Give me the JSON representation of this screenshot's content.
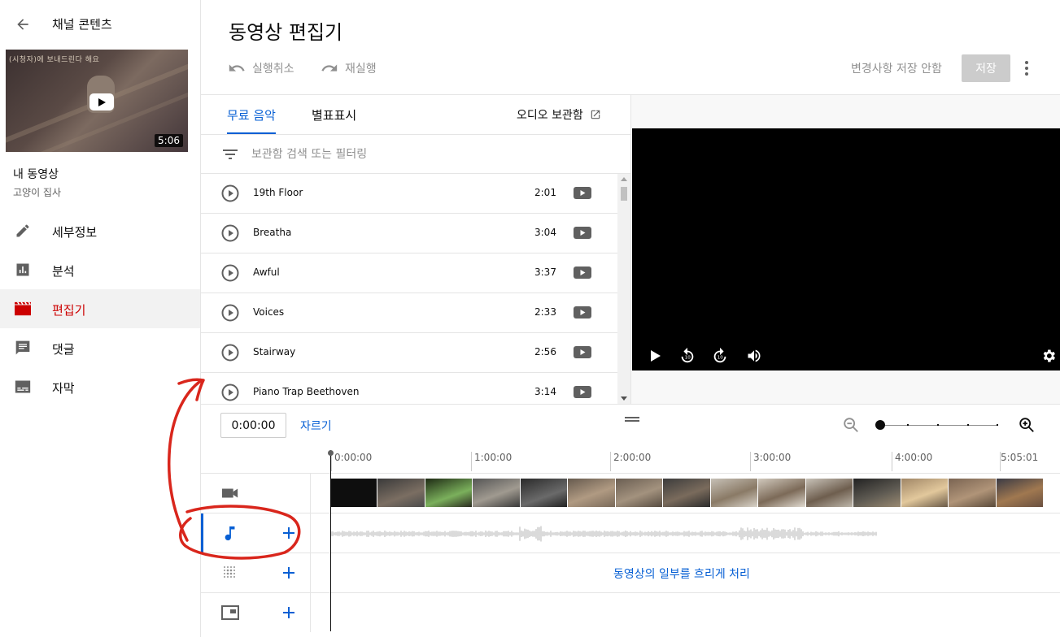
{
  "sidebar": {
    "back_label": "채널 콘텐츠",
    "video": {
      "duration": "5:06",
      "thumb_caption": "(시청자)에 보내드린다 해요"
    },
    "my_video_label": "내 동영상",
    "owner": "고양이 집사",
    "items": [
      {
        "label": "세부정보",
        "icon": "pencil-icon"
      },
      {
        "label": "분석",
        "icon": "analytics-icon"
      },
      {
        "label": "편집기",
        "icon": "clapperboard-icon",
        "active": true
      },
      {
        "label": "댓글",
        "icon": "comment-icon"
      },
      {
        "label": "자막",
        "icon": "subtitles-icon"
      }
    ]
  },
  "header": {
    "title": "동영상 편집기",
    "undo": "실행취소",
    "redo": "재실행",
    "discard": "변경사항 저장 안함",
    "save": "저장"
  },
  "panel": {
    "tabs": [
      "무료 음악",
      "별표표시"
    ],
    "active_tab": 0,
    "audio_library": "오디오 보관함",
    "filter_placeholder": "보관함 검색 또는 필터링",
    "tracks": [
      {
        "name": "19th Floor",
        "duration": "2:01"
      },
      {
        "name": "Breatha",
        "duration": "3:04"
      },
      {
        "name": "Awful",
        "duration": "3:37"
      },
      {
        "name": "Voices",
        "duration": "2:33"
      },
      {
        "name": "Stairway",
        "duration": "2:56"
      },
      {
        "name": "Piano Trap Beethoven",
        "duration": "3:14"
      }
    ]
  },
  "timeline": {
    "current_time": "0:00:00",
    "trim": "자르기",
    "ruler": [
      "0:00:00",
      "1:00:00",
      "2:00:00",
      "3:00:00",
      "4:00:00",
      "5:05:01"
    ],
    "blur_label": "동영상의 일부를 흐리게 처리",
    "lanes": [
      "video-icon",
      "music-note-icon",
      "blur-grid-icon",
      "end-screen-icon"
    ]
  },
  "colors": {
    "accent": "#065fd4",
    "active_nav": "#cc0000",
    "annotation": "#d9261c"
  }
}
